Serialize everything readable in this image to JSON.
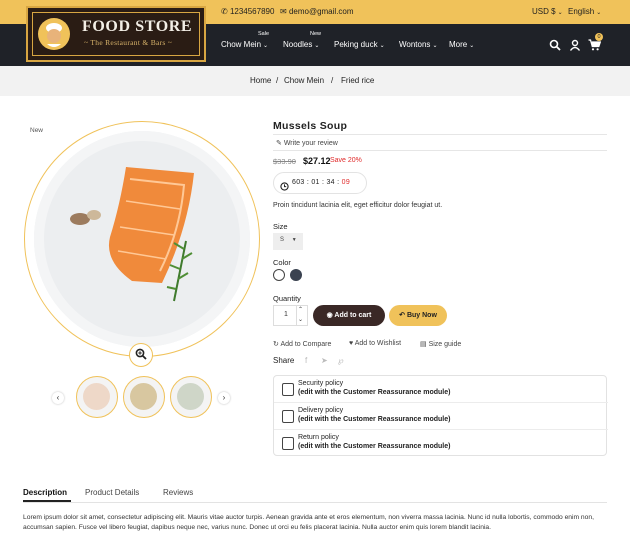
{
  "topbar": {
    "phone": "1234567890",
    "email": "demo@gmail.com",
    "currency": "USD $",
    "language": "English"
  },
  "logo": {
    "title": "FOOD STORE",
    "subtitle": "~ The Restaurant & Bars ~"
  },
  "nav": {
    "items": [
      {
        "label": "Chow Mein",
        "badge": "Sale"
      },
      {
        "label": "Noodles",
        "badge": "New"
      },
      {
        "label": "Peking duck",
        "badge": ""
      },
      {
        "label": "Wontons",
        "badge": ""
      },
      {
        "label": "More",
        "badge": ""
      }
    ],
    "cart_count": "0"
  },
  "breadcrumb": {
    "items": [
      "Home",
      "Chow Mein",
      "Fried rice"
    ],
    "separator": "/"
  },
  "product": {
    "flag": "New",
    "title": "Mussels Soup",
    "review_link": "Write your review",
    "old_price": "$33.90",
    "price": "$27.12",
    "discount": "Save 20%",
    "timer": {
      "days": "603",
      "hours": "01",
      "minutes": "34",
      "seconds": "09"
    },
    "description": "Proin tincidunt lacinia elit, eget efficitur dolor feugiat ut.",
    "size_label": "Size",
    "size_value": "S",
    "color_label": "Color",
    "colors": [
      "#ffffff",
      "#3a4250"
    ],
    "quantity_label": "Quantity",
    "quantity": "1",
    "add_to_cart": "Add to cart",
    "buy_now": "Buy Now",
    "compare": "Add to Compare",
    "wishlist": "Add to Wishlist",
    "size_guide": "Size guide",
    "share_label": "Share"
  },
  "reassurance": [
    {
      "title": "Security policy",
      "note": "(edit with the Customer Reassurance module)"
    },
    {
      "title": "Delivery policy",
      "note": "(edit with the Customer Reassurance module)"
    },
    {
      "title": "Return policy",
      "note": "(edit with the Customer Reassurance module)"
    }
  ],
  "tabs": {
    "items": [
      "Description",
      "Product Details",
      "Reviews"
    ],
    "active": "Description",
    "content": "Lorem ipsum dolor sit amet, consectetur adipiscing elit. Mauris vitae auctor turpis. Aenean gravida ante et eros elementum, non viverra massa lacinia. Nunc id nulla lobortis, commodo enim non, accumsan sapien. Fusce vel libero feugiat, dapibus neque nec, varius nunc. Donec ut orci eu felis placerat lacinia. Nulla auctor enim quis lorem blandit lacinia."
  },
  "colors": {
    "accent": "#f0c25a",
    "nav_bg": "#1f2228",
    "cart_button": "#3a2826",
    "sale_red": "#e02b2b"
  }
}
